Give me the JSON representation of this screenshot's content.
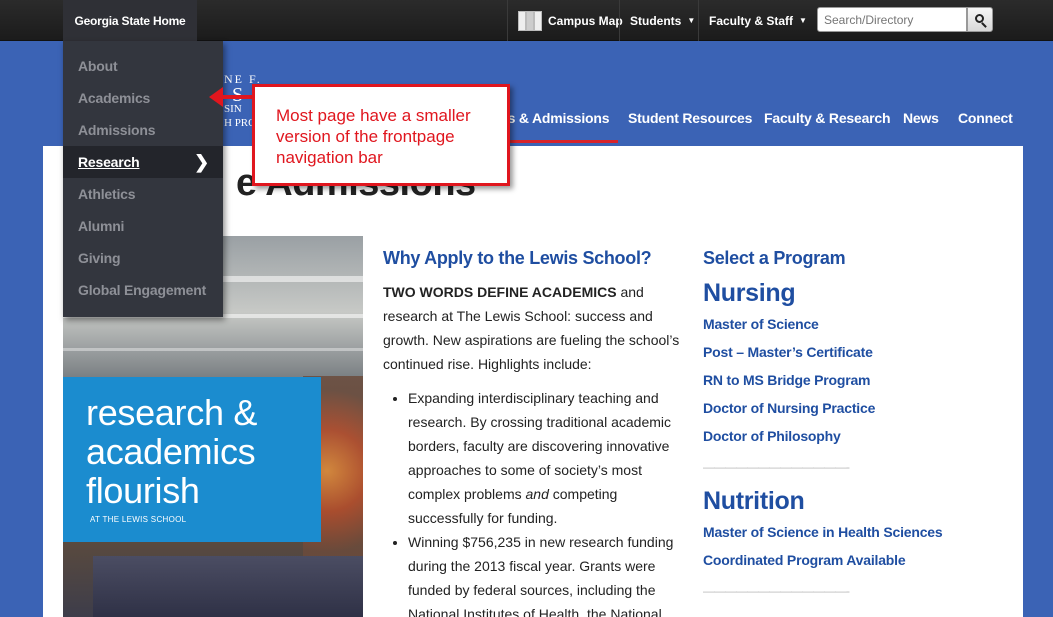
{
  "topbar": {
    "home_label": "Georgia State Home",
    "campus_map": "Campus Map",
    "students": "Students",
    "faculty_staff": "Faculty & Staff",
    "search_placeholder": "Search/Directory"
  },
  "logo_fragments": [
    "NE F.",
    "S",
    "SIN",
    "H PRO"
  ],
  "main_nav": {
    "academics_admissions": "cs & Admissions",
    "student_resources": "Student Resources",
    "faculty_research": "Faculty & Research",
    "news": "News",
    "connect": "Connect"
  },
  "page_title": "e Admissions",
  "dropdown": {
    "items": [
      "About",
      "Academics",
      "Admissions",
      "Research",
      "Athletics",
      "Alumni",
      "Giving",
      "Global Engagement"
    ],
    "active_index": 3
  },
  "annotation": "Most page have a smaller version of the frontpage navigation bar",
  "promo": {
    "line1": "research &",
    "line2": "academics",
    "line3": "flourish",
    "sub": "AT THE LEWIS SCHOOL"
  },
  "middle": {
    "heading": "Why Apply to the Lewis School?",
    "intro_bold": "TWO WORDS DEFINE ACADEMICS",
    "intro_rest": " and research at The Lewis School: success and growth.  New aspirations are fueling the school’s continued rise. Highlights include:",
    "bullet1_a": "Expanding interdisciplinary teaching and research. By crossing traditional academic borders, faculty are discovering innovative approaches to some of society’s most complex problems ",
    "bullet1_em": "and",
    "bullet1_b": " competing successfully for funding.",
    "bullet2": "Winning $756,235 in new research funding during the 2013 fiscal year. Grants were funded by federal sources, including the National Institutes of Health, the National"
  },
  "programs": {
    "heading": "Select a Program",
    "separator": "—————————————-",
    "nursing": {
      "title": "Nursing",
      "links": [
        "Master of Science",
        "Post – Master’s Certificate",
        "RN to MS Bridge Program",
        "Doctor of Nursing Practice",
        "Doctor of Philosophy"
      ]
    },
    "nutrition": {
      "title": "Nutrition",
      "links": [
        "Master of Science in Health Sciences",
        "Coordinated Program Available"
      ]
    }
  },
  "colors": {
    "brand_blue": "#3b63b5",
    "link_blue": "#1f4ea1",
    "annotation_red": "#e0161e",
    "promo_blue": "#1b8ccf"
  }
}
